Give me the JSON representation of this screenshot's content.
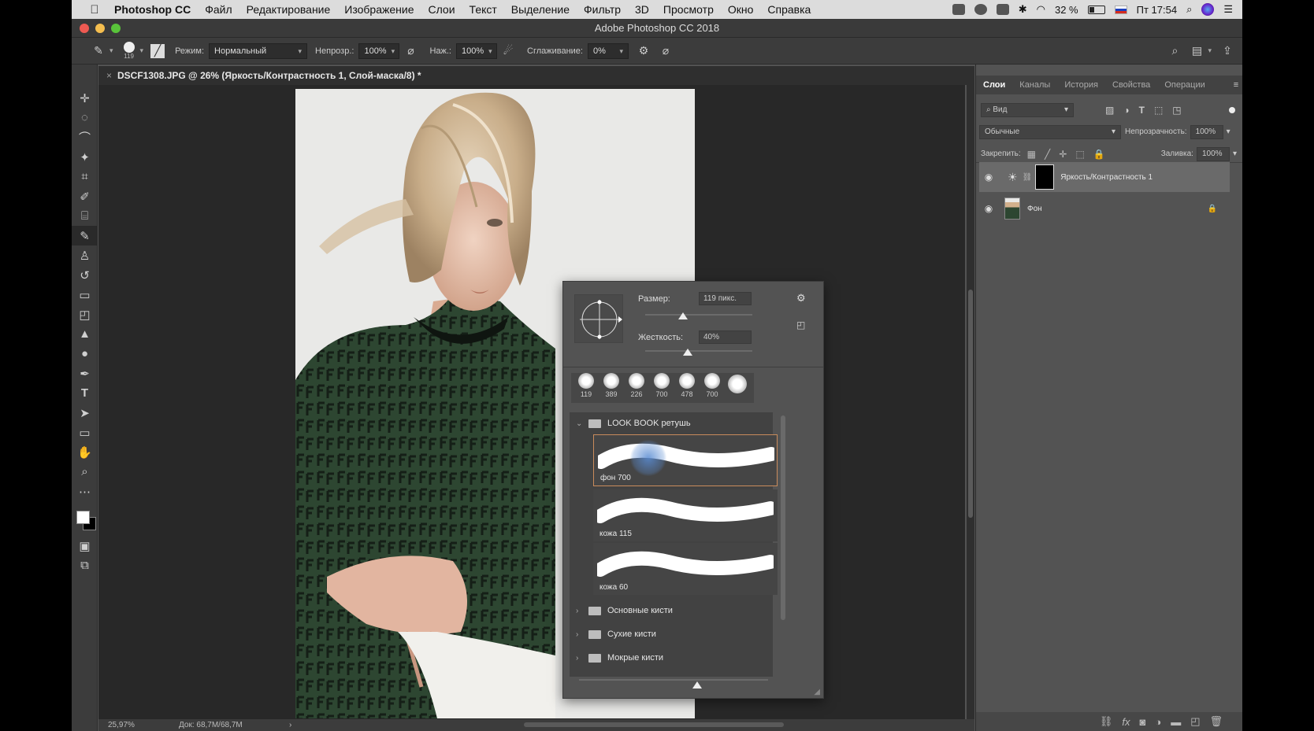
{
  "menubar": {
    "app_name": "Photoshop CC",
    "items": [
      "Файл",
      "Редактирование",
      "Изображение",
      "Слои",
      "Текст",
      "Выделение",
      "Фильтр",
      "3D",
      "Просмотр",
      "Окно",
      "Справка"
    ],
    "battery": "32 %",
    "clock": "Пт 17:54"
  },
  "titlebar": {
    "title": "Adobe Photoshop CC 2018"
  },
  "options": {
    "brush_size": "119",
    "mode_label": "Режим:",
    "mode_value": "Нормальный",
    "opacity_label": "Непрозр.:",
    "opacity_value": "100%",
    "pressure_label": "Наж.:",
    "pressure_value": "100%",
    "smoothing_label": "Сглаживание:",
    "smoothing_value": "0%"
  },
  "document": {
    "tab_title": "DSCF1308.JPG @ 26% (Яркость/Контрастность 1, Слой-маска/8) *",
    "zoom": "25,97%",
    "doc_info": "Док: 68,7M/68,7M"
  },
  "brush_picker": {
    "size_label": "Размер:",
    "size_value": "119 пикс.",
    "size_level": 0.35,
    "hardness_label": "Жесткость:",
    "hardness_value": "40%",
    "hardness_level": 0.4,
    "presets": [
      "119",
      "389",
      "226",
      "700",
      "478",
      "700"
    ],
    "open_folder": "LOOK BOOK ретушь",
    "brushes": [
      "фон 700",
      "кожа 115",
      "кожа 60"
    ],
    "folders": [
      "Основные кисти",
      "Сухие кисти",
      "Мокрые кисти"
    ]
  },
  "layers_panel": {
    "tabs": [
      "Слои",
      "Каналы",
      "История",
      "Свойства",
      "Операции"
    ],
    "filter_placeholder": "Вид",
    "blend_mode": "Обычные",
    "opacity_label": "Непрозрачность:",
    "opacity_value": "100%",
    "lock_label": "Закрепить:",
    "fill_label": "Заливка:",
    "fill_value": "100%",
    "layers": [
      {
        "name": "Яркость/Контрастность 1"
      },
      {
        "name": "Фон"
      }
    ]
  },
  "colors": {
    "accent_selection": "#c98b5c",
    "panel_bg": "#535353",
    "canvas_bg": "#282828"
  }
}
